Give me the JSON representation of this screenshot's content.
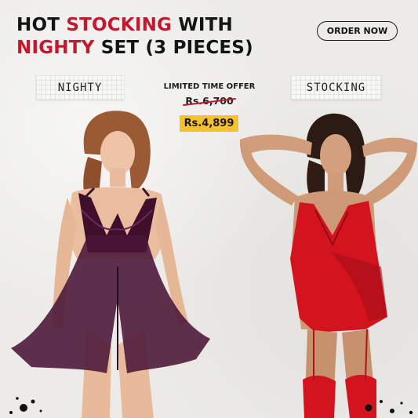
{
  "headline": {
    "line1_a": "HOT ",
    "line1_b": "STOCKING",
    "line1_c": " WITH",
    "line2_a": "NIGHTY",
    "line2_b": " SET (3 PIECES)"
  },
  "order_button": "ORDER NOW",
  "tags": {
    "left": "NIGHTY",
    "right": "STOCKING"
  },
  "offer": {
    "label": "LIMITED TIME OFFER",
    "old_price": "Rs.6,700",
    "new_price": "Rs.4,899"
  },
  "colors": {
    "accent_red": "#c4182e",
    "price_badge": "#f4c22e",
    "nighty": "#4a1536",
    "stocking": "#d3141e"
  },
  "images": {
    "left": "model-in-purple-nighty",
    "right": "model-in-red-stocking-set"
  }
}
